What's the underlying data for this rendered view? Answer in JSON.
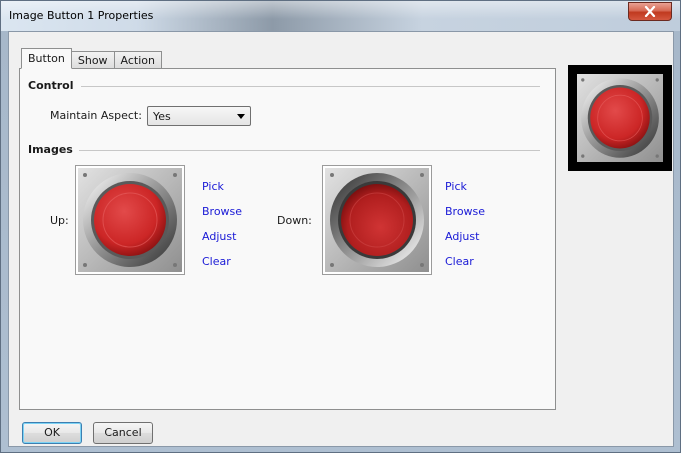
{
  "window": {
    "title": "Image Button 1 Properties"
  },
  "tabs": [
    {
      "label": "Button",
      "active": true
    },
    {
      "label": "Show",
      "active": false
    },
    {
      "label": "Action",
      "active": false
    }
  ],
  "control": {
    "section_title": "Control",
    "maintain_aspect_label": "Maintain Aspect:",
    "maintain_aspect_value": "Yes"
  },
  "images": {
    "section_title": "Images",
    "up": {
      "label": "Up:",
      "links": [
        "Pick",
        "Browse",
        "Adjust",
        "Clear"
      ]
    },
    "down": {
      "label": "Down:",
      "links": [
        "Pick",
        "Browse",
        "Adjust",
        "Clear"
      ]
    }
  },
  "footer": {
    "ok_label": "OK",
    "cancel_label": "Cancel"
  },
  "colors": {
    "link": "#1a1ad6",
    "button_red": "#d42a2a",
    "close_red": "#c0391f"
  },
  "icons": {
    "close": "close-icon",
    "dropdown": "chevron-down-icon",
    "image": "red-push-button-image"
  }
}
